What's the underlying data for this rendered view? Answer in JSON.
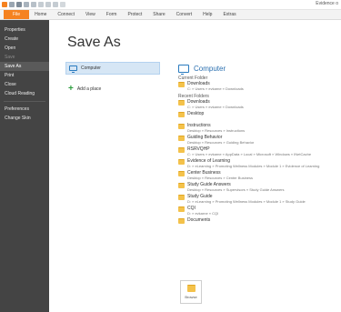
{
  "window": {
    "title": "Evidence o"
  },
  "qat_icons": [
    "app-icon",
    "save-icon",
    "floppy-icon",
    "print-icon",
    "table-icon",
    "undo-icon",
    "redo-icon",
    "sync-icon",
    "more-icon"
  ],
  "ribbon": {
    "file_tab": "File",
    "tabs": [
      "Home",
      "Connect",
      "View",
      "Form",
      "Protect",
      "Share",
      "Convert",
      "Help",
      "Extras"
    ]
  },
  "sidebar": {
    "items": [
      {
        "label": "Properties",
        "state": "normal"
      },
      {
        "label": "Create",
        "state": "normal"
      },
      {
        "label": "Open",
        "state": "normal"
      },
      {
        "label": "Save",
        "state": "dim"
      },
      {
        "label": "Save As",
        "state": "active"
      },
      {
        "label": "Print",
        "state": "normal"
      },
      {
        "label": "Close",
        "state": "normal"
      },
      {
        "label": "Cloud Reading",
        "state": "normal"
      },
      {
        "label": "Preferences",
        "state": "normal"
      },
      {
        "label": "Change Skin",
        "state": "normal"
      }
    ]
  },
  "page_title": "Save As",
  "places": {
    "computer": "Computer",
    "add_place": "Add a place"
  },
  "detail": {
    "heading": "Computer",
    "current_folder_label": "Current Folder",
    "current": [
      {
        "name": "Downloads",
        "path": "C: » Users » evkarne » Downloads"
      }
    ],
    "recent_folders_label": "Recent Folders",
    "recent": [
      {
        "name": "Downloads",
        "path": "C: » Users » evkarne » Downloads"
      },
      {
        "name": "Desktop",
        "path": ""
      },
      {
        "name": "Instructions",
        "path": "Desktop » Resources » Instructions"
      },
      {
        "name": "Guiding Behavior",
        "path": "Desktop » Resources » Guiding Behavior"
      },
      {
        "name": "RSRVQHP",
        "path": "C: » Users » evkarne » AppData » Local » Microsoft » Windows » INetCache"
      },
      {
        "name": "Evidence of Learning",
        "path": "D: » eLearning » Promoting Wellness Modules » Module 1 » Evidence of Learning"
      },
      {
        "name": "Center Business",
        "path": "Desktop » Resources » Center Business"
      },
      {
        "name": "Study Guide Answers",
        "path": "Desktop » Resources » Supervisors » Study Guide Answers"
      },
      {
        "name": "Study Guide",
        "path": "D: » eLearning » Promoting Wellness Modules » Module 1 » Study Guide"
      },
      {
        "name": "CQI",
        "path": "D: » evkarne » CQI"
      },
      {
        "name": "Documents",
        "path": ""
      }
    ]
  },
  "browse_label": "Browse",
  "colors": {
    "file_tab": "#f58220",
    "sidebar_bg": "#444444",
    "selected_place": "#d6e6f5",
    "heading_blue": "#2a6fb0",
    "folder": "#f4c24b",
    "add_green": "#2e9e3f"
  }
}
